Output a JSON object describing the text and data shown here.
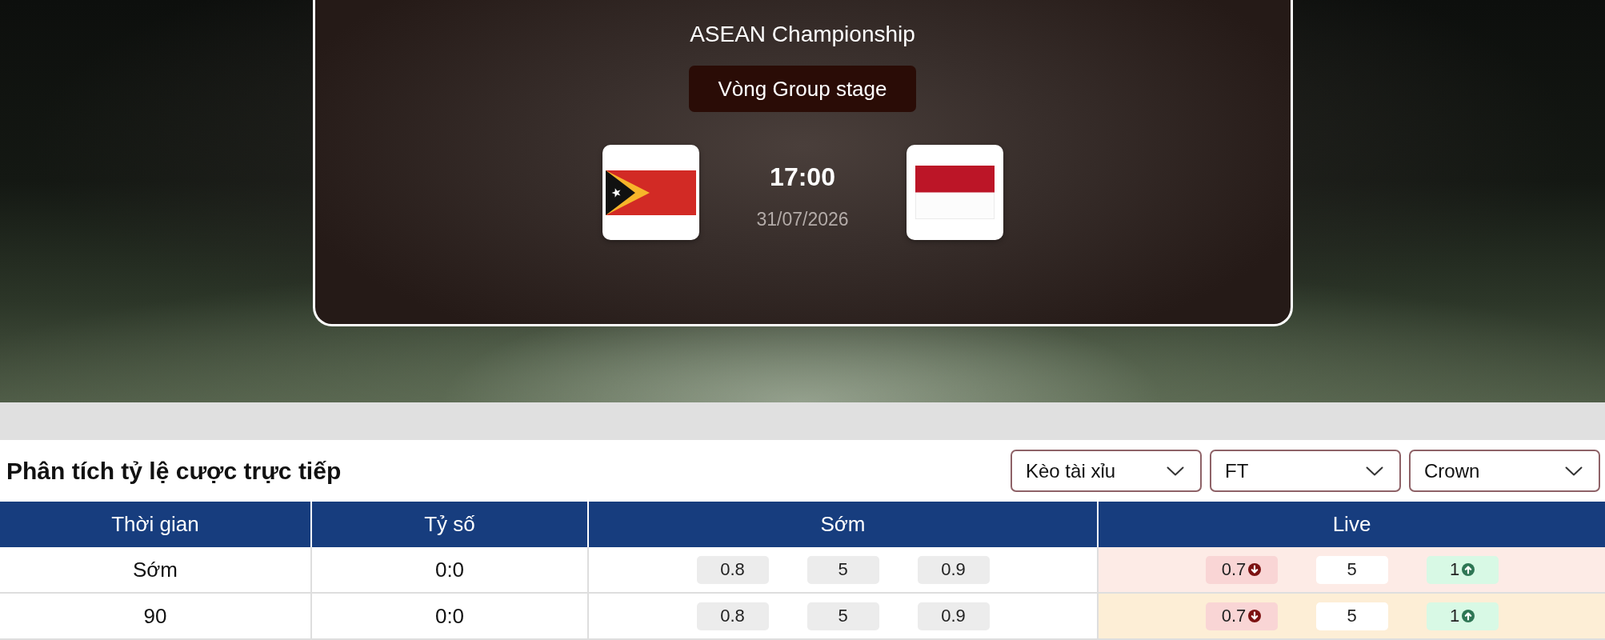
{
  "match": {
    "competition": "ASEAN Championship",
    "round": "Vòng Group stage",
    "time": "17:00",
    "date": "31/07/2026"
  },
  "odds": {
    "title": "Phân tích tỷ lệ cược trực tiếp",
    "filters": [
      {
        "value": "Kèo tài xỉu"
      },
      {
        "value": "FT"
      },
      {
        "value": "Crown"
      }
    ],
    "table": {
      "columns": [
        "Thời gian",
        "Tỷ số",
        "Sớm",
        "Live"
      ],
      "rows": [
        {
          "time": "Sớm",
          "score": "0:0",
          "early": [
            "0.8",
            "5",
            "0.9"
          ],
          "live": {
            "color": "#fdebe6",
            "values": [
              {
                "value": "0.7",
                "kind": "down"
              },
              {
                "value": "5",
                "kind": "flat"
              },
              {
                "value": "1",
                "kind": "up"
              }
            ]
          }
        },
        {
          "time": "90",
          "score": "0:0",
          "early": [
            "0.8",
            "5",
            "0.9"
          ],
          "live": {
            "color": "#fdeed6",
            "values": [
              {
                "value": "0.7",
                "kind": "down"
              },
              {
                "value": "5",
                "kind": "flat"
              },
              {
                "value": "1",
                "kind": "up"
              }
            ]
          }
        }
      ]
    }
  }
}
